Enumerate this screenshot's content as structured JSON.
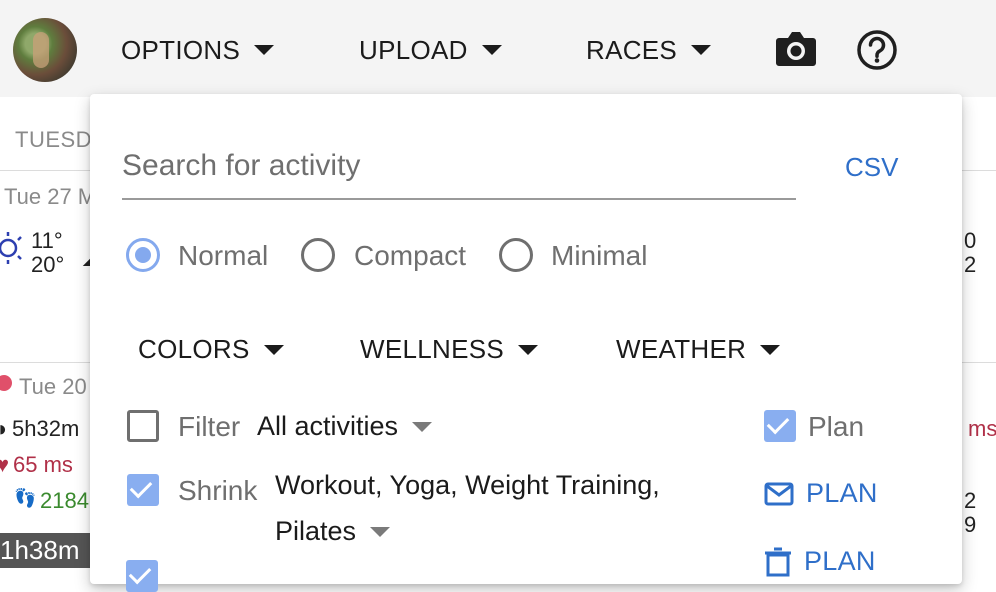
{
  "topbar": {
    "menus": [
      {
        "label": "OPTIONS"
      },
      {
        "label": "UPLOAD"
      },
      {
        "label": "RACES"
      }
    ],
    "icons": [
      "camera-icon",
      "help-icon"
    ]
  },
  "background": {
    "day_header": "TUESDA",
    "day1_date": "Tue 27 M",
    "temp_high": "11°",
    "temp_low": "20°",
    "day2_date": "Tue 20",
    "duration": "5h32m",
    "hrv": "65 ms",
    "steps": "2184",
    "bar_time": "1h38m",
    "right_digits": [
      "0",
      "2",
      "ms",
      "2",
      "9"
    ]
  },
  "panel": {
    "search_placeholder": "Search for activity",
    "csv_label": "CSV",
    "view_modes": [
      {
        "label": "Normal",
        "selected": true
      },
      {
        "label": "Compact",
        "selected": false
      },
      {
        "label": "Minimal",
        "selected": false
      }
    ],
    "submenus": [
      {
        "label": "COLORS"
      },
      {
        "label": "WELLNESS"
      },
      {
        "label": "WEATHER"
      }
    ],
    "filter": {
      "label": "Filter",
      "checked": false,
      "value": "All activities"
    },
    "plan_check": {
      "label": "Plan",
      "checked": true
    },
    "shrink": {
      "label": "Shrink",
      "checked": true,
      "value_line1": "Workout, Yoga, Weight Training,",
      "value_line2": "Pilates"
    },
    "email_plan_label": "PLAN",
    "delete_plan_label": "PLAN"
  },
  "colors": {
    "accent": "#2f6fc9",
    "radio_selected": "#84a9ee",
    "hrv_red": "#b03048",
    "steps_green": "#3a8a2e"
  }
}
